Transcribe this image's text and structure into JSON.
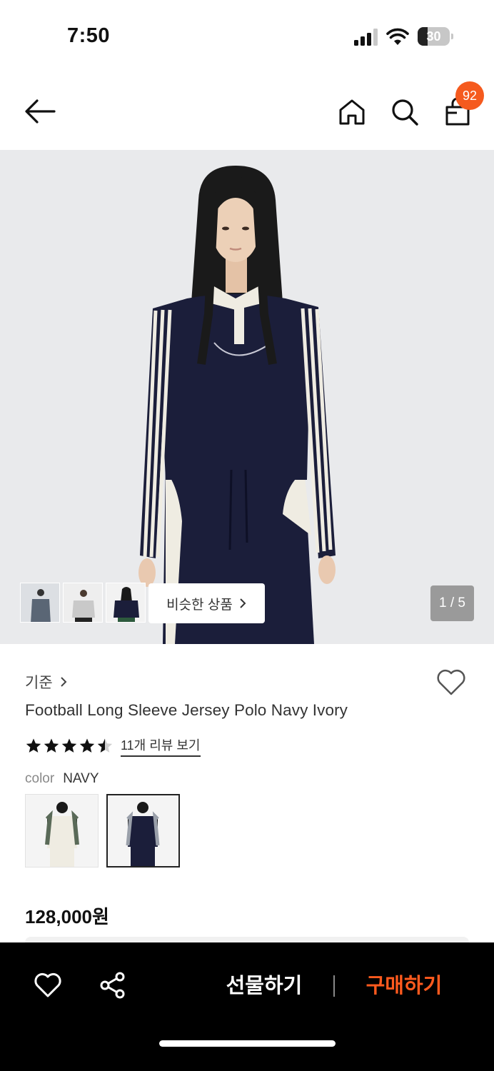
{
  "status_bar": {
    "time": "7:50",
    "battery": "30",
    "battery_level": 0.3
  },
  "header": {
    "cart_badge": "92",
    "icons": [
      "back-arrow-icon",
      "home-icon",
      "search-icon",
      "shopping-bag-icon"
    ]
  },
  "gallery": {
    "similar_label": "비슷한 상품",
    "page_indicator": "1 / 5"
  },
  "product": {
    "brand": "기준",
    "name": "Football Long Sleeve Jersey Polo Navy Ivory",
    "rating": 4.5,
    "review_link": "11개 리뷰 보기",
    "color_label": "color",
    "color_value": "NAVY",
    "price": "128,000원"
  },
  "bottom_bar": {
    "gift_label": "선물하기",
    "buy_label": "구매하기",
    "buy_color": "#ff5a1e"
  },
  "colors": {
    "accent": "#f55a1e",
    "navy": "#1b1e3a",
    "ivory": "#efece2"
  }
}
